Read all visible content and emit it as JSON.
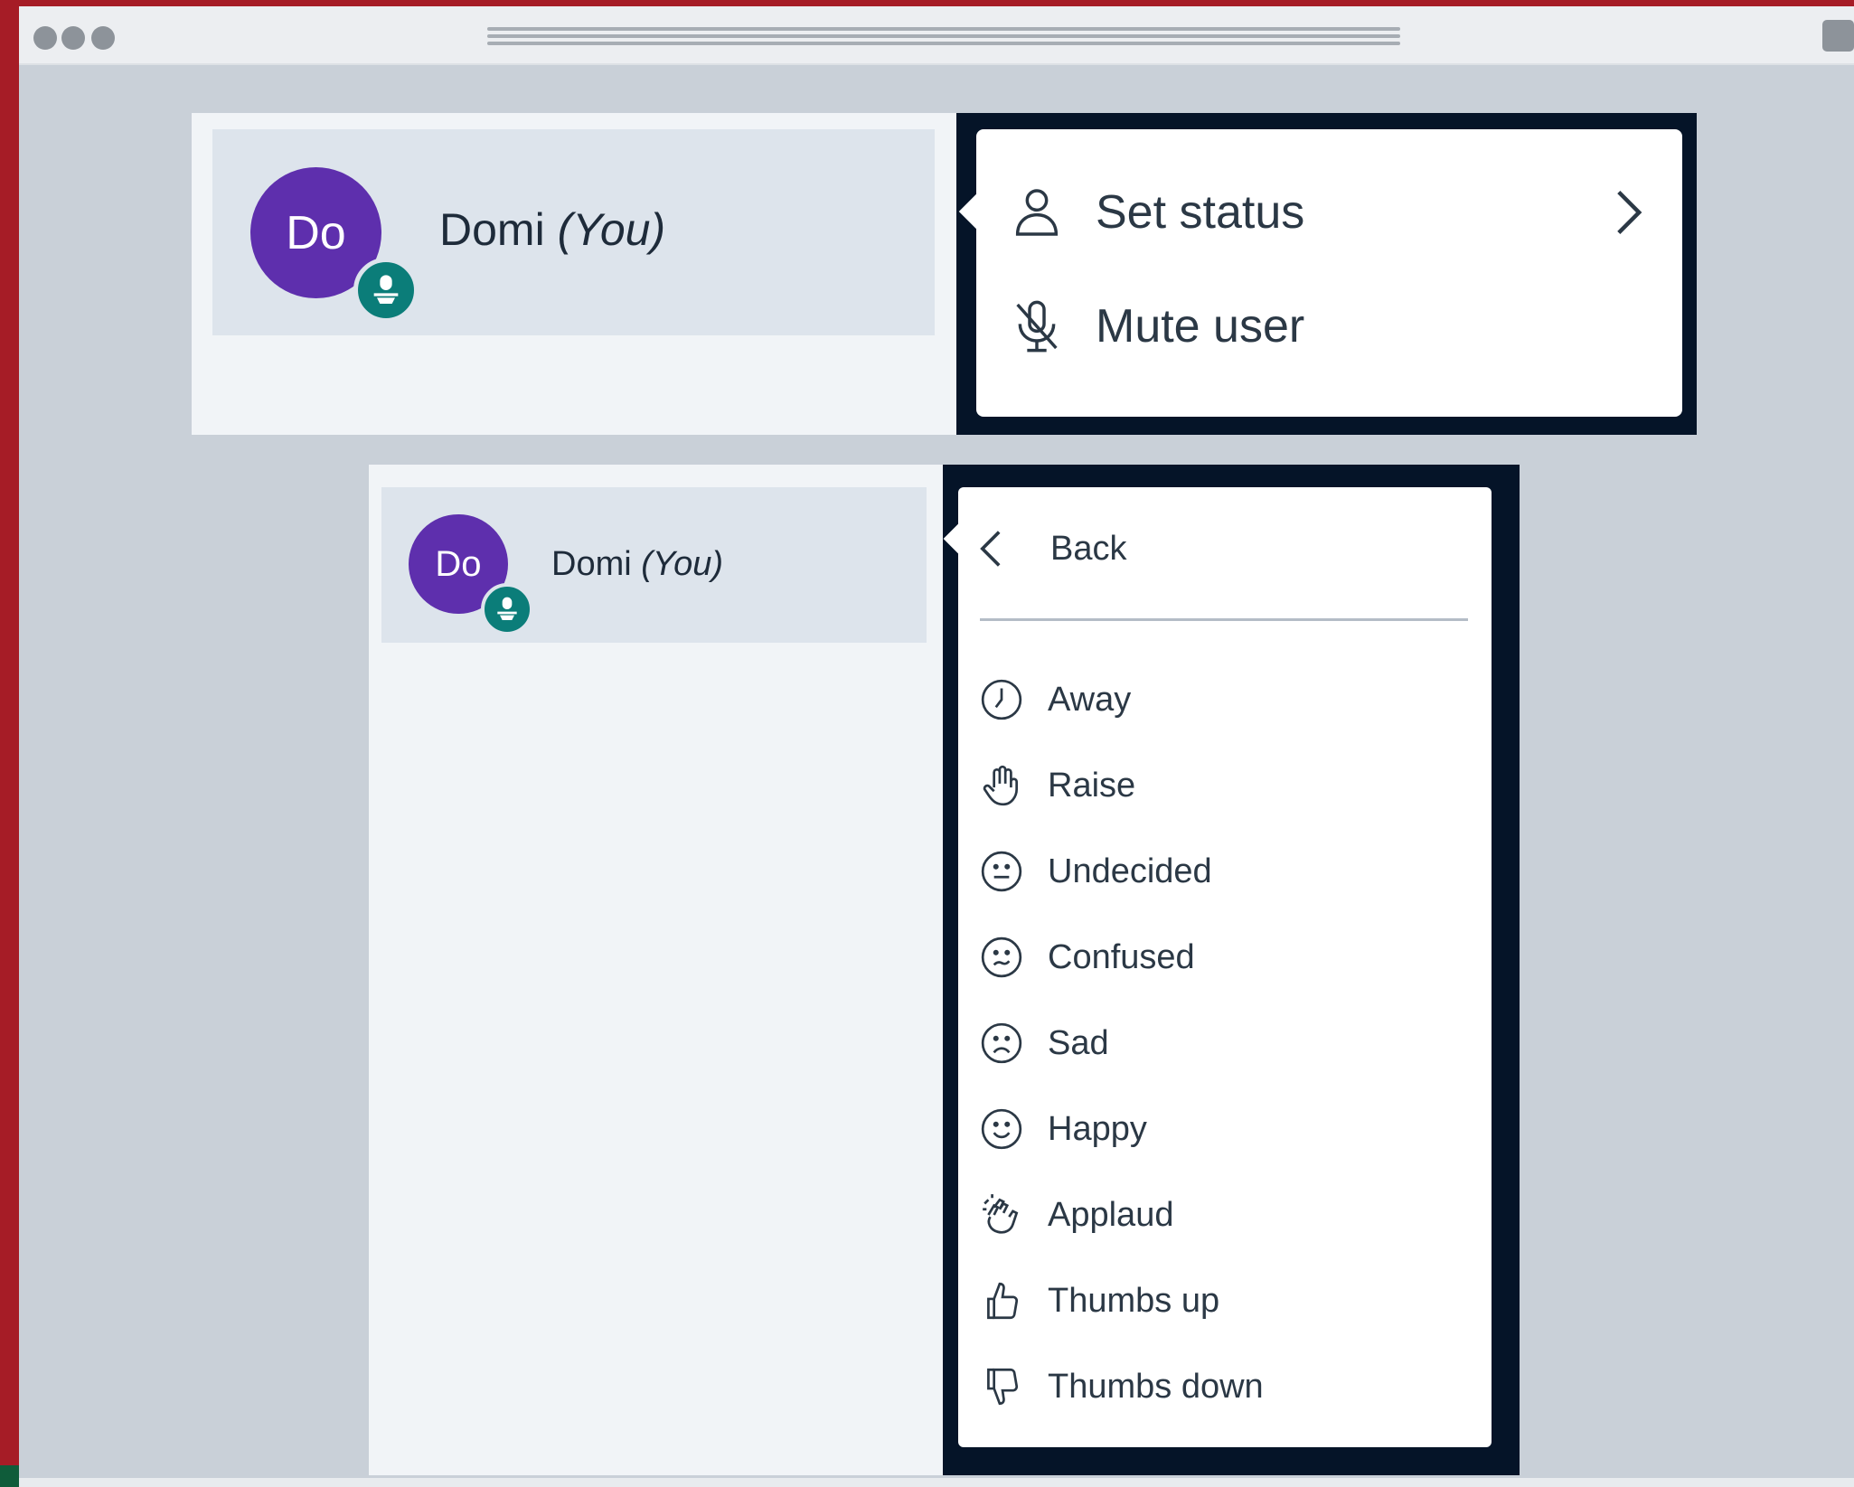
{
  "window": {
    "icons": [
      "window-dot-icon",
      "window-dot-icon",
      "window-dot-icon",
      "menu-lines-icon",
      "window-button-icon"
    ]
  },
  "user_card_large": {
    "avatar_initials": "Do",
    "name": "Domi",
    "you_label": "(You)",
    "badge_icon": "presenter-icon"
  },
  "context_menu": {
    "items": [
      {
        "label": "Set status",
        "icon": "user-icon",
        "trailing_icon": "chevron-right-icon"
      },
      {
        "label": "Mute user",
        "icon": "mic-off-icon"
      }
    ]
  },
  "user_card_small": {
    "avatar_initials": "Do",
    "name": "Domi",
    "you_label": "(You)",
    "badge_icon": "presenter-icon"
  },
  "status_menu": {
    "back_label": "Back",
    "back_icon": "chevron-left-icon",
    "items": [
      {
        "label": "Away",
        "icon": "clock-icon"
      },
      {
        "label": "Raise",
        "icon": "hand-icon"
      },
      {
        "label": "Undecided",
        "icon": "neutral-face-icon"
      },
      {
        "label": "Confused",
        "icon": "confused-face-icon"
      },
      {
        "label": "Sad",
        "icon": "sad-face-icon"
      },
      {
        "label": "Happy",
        "icon": "happy-face-icon"
      },
      {
        "label": "Applaud",
        "icon": "applaud-icon"
      },
      {
        "label": "Thumbs up",
        "icon": "thumbs-up-icon"
      },
      {
        "label": "Thumbs down",
        "icon": "thumbs-down-icon"
      }
    ]
  },
  "colors": {
    "avatar": "#5e2fad",
    "badge": "#0b7d79",
    "menu_frame": "#051428",
    "row_highlight": "#dde4ec",
    "page_background": "#c9d0d8",
    "left_edge": "#a61c26"
  }
}
